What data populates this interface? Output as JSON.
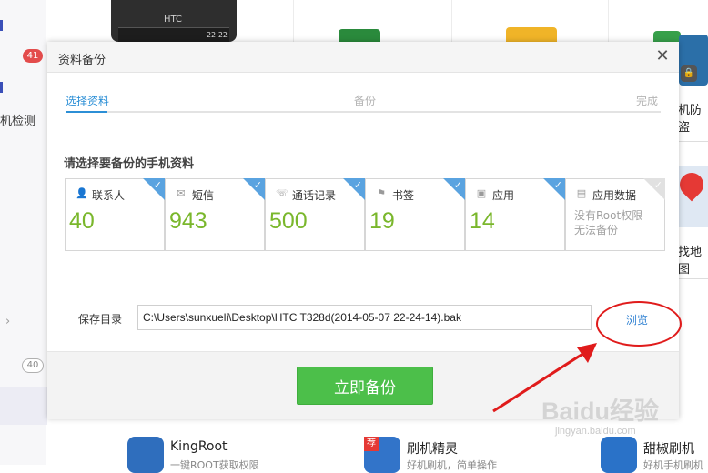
{
  "background": {
    "sidebar": {
      "badge_count": "41",
      "detect_label": "机检测",
      "chevron": "›",
      "outline_badge": "40"
    },
    "phone": {
      "brand": "HTC",
      "time": "22:22"
    },
    "right_column": {
      "item1": "机防盗",
      "item2": "找地图"
    },
    "apps": [
      {
        "name": "KingRoot",
        "desc": "一键ROOT获取权限",
        "color": "#2f6ebd"
      },
      {
        "name": "刷机精灵",
        "desc": "好机刷机，简单操作",
        "badge": "荐",
        "color": "#3274c9"
      },
      {
        "name": "甜椒刷机",
        "desc": "好机手机刷机",
        "color": "#2a72c8"
      }
    ]
  },
  "dialog": {
    "title": "资料备份",
    "close_icon": "✕",
    "steps": [
      {
        "label": "选择资料",
        "state": "active"
      },
      {
        "label": "备份",
        "state": "inactive"
      },
      {
        "label": "完成",
        "state": "inactive"
      }
    ],
    "step_progress": 0.07,
    "section_title": "请选择要备份的手机资料",
    "cards": [
      {
        "label": "联系人",
        "count": "40",
        "icon": "person-icon",
        "checked": true
      },
      {
        "label": "短信",
        "count": "943",
        "icon": "sms-icon",
        "checked": true
      },
      {
        "label": "通话记录",
        "count": "500",
        "icon": "phone-icon",
        "checked": true
      },
      {
        "label": "书签",
        "count": "19",
        "icon": "bookmark-icon",
        "checked": true
      },
      {
        "label": "应用",
        "count": "14",
        "icon": "app-icon",
        "checked": true
      },
      {
        "label": "应用数据",
        "note": "没有Root权限无法备份",
        "icon": "app-data-icon",
        "checked": false
      }
    ],
    "save_dir_label": "保存目录",
    "save_path": "C:\\Users\\sunxueli\\Desktop\\HTC T328d(2014-05-07 22-24-14).bak",
    "browse_label": "浏览",
    "backup_button": "立即备份"
  },
  "watermark": {
    "text": "Baidu经验",
    "sub": "jingyan.baidu.com"
  },
  "colors": {
    "accent_blue": "#2c8fd6",
    "count_green": "#7ab72c",
    "button_green": "#4cbf4a",
    "annotation_red": "#e01b1b"
  }
}
